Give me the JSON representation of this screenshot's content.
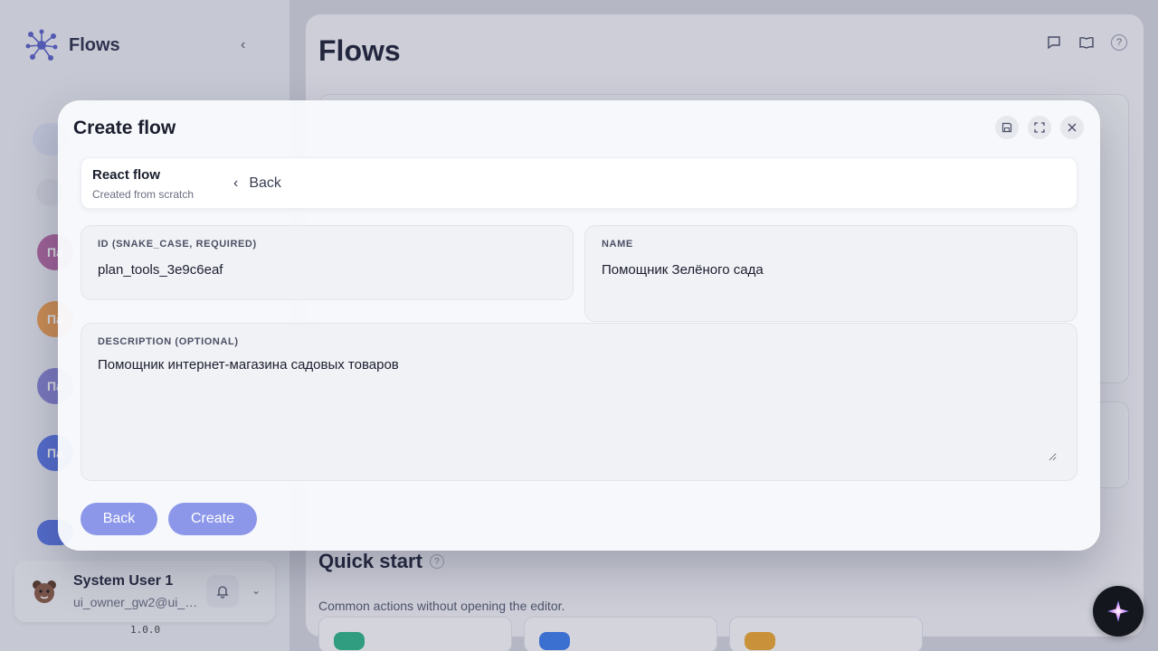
{
  "app": {
    "name": "Flows",
    "version": "1.0.0"
  },
  "sidebar": {
    "avatars": [
      "Па",
      "Па",
      "Па",
      "Па"
    ]
  },
  "user": {
    "name": "System User 1",
    "email": "ui_owner_gw2@ui_e..."
  },
  "main": {
    "title": "Flows",
    "quick_start": {
      "title": "Quick start",
      "help": "?",
      "subtitle": "Common actions without opening the editor."
    }
  },
  "top_icons": {
    "help": "?"
  },
  "modal": {
    "title": "Create flow",
    "flow": {
      "name": "React flow",
      "subtitle": "Created from scratch",
      "back_label": "Back"
    },
    "fields": {
      "id": {
        "label": "ID (SNAKE_CASE, REQUIRED)",
        "value": "plan_tools_3e9c6eaf"
      },
      "name": {
        "label": "NAME",
        "value": "Помощник Зелёного сада"
      },
      "description": {
        "label": "DESCRIPTION (OPTIONAL)",
        "value": "Помощник интернет-магазина садовых товаров"
      }
    },
    "buttons": {
      "back": "Back",
      "create": "Create"
    }
  },
  "colors": {
    "accent": "#8c97ea",
    "overlay": "#3c4060"
  }
}
